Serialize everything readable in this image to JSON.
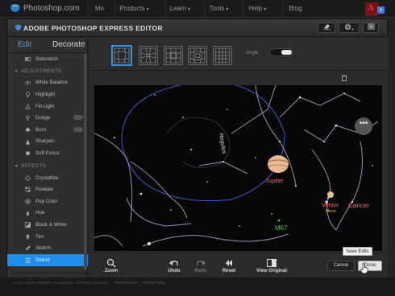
{
  "site": {
    "logo_text": "Photoshop.com",
    "nav": [
      "Me",
      "Products",
      "Learn",
      "Tools",
      "Help",
      "Blog"
    ],
    "adobe_badge": "A",
    "close": "x"
  },
  "editor": {
    "title": "ADOBE PHOTOSHOP EXPRESS EDITOR",
    "header_tools": [
      "eraser-icon",
      "gear-icon",
      "fullscreen-icon"
    ]
  },
  "sidebar": {
    "tabs": {
      "edit": "Edit",
      "decorate": "Decorate"
    },
    "top_item": "Saturation",
    "sections": [
      {
        "title": "ADJUSTMENTS",
        "items": [
          "White Balance",
          "Highlight",
          "Fill Light",
          "Dodge",
          "Burn",
          "Sharpen",
          "Soft Focus"
        ]
      },
      {
        "title": "EFFECTS",
        "items": [
          "Crystallize",
          "Pixelate",
          "Pop Color",
          "Hue",
          "Black & White",
          "Tint",
          "Sketch",
          "Distort"
        ]
      }
    ],
    "selected": "Distort"
  },
  "options": {
    "angle_label": "Angle:",
    "presets": [
      "distort-preset-1",
      "distort-preset-2",
      "distort-preset-3",
      "distort-preset-4",
      "distort-preset-5"
    ]
  },
  "canvas": {
    "labels": {
      "jupiter": "Jupiter",
      "venus": "Venus",
      "moon": "Moon",
      "cancer": "Cancer",
      "m67": "M67",
      "regulus": "Regulus"
    },
    "more": "•••"
  },
  "toolbar": {
    "zoom": "Zoom",
    "undo": "Undo",
    "redo": "Redo",
    "reset": "Reset",
    "view_original": "View Original",
    "cancel": "Cancel",
    "done": "Done",
    "tooltip": "Save Edits"
  },
  "footer": {
    "copyright": "© 2012 Adobe Systems Incorporated. All Rights Reserved.",
    "terms": "Terms of Use",
    "privacy": "Privacy Policy",
    "separator": "|"
  }
}
